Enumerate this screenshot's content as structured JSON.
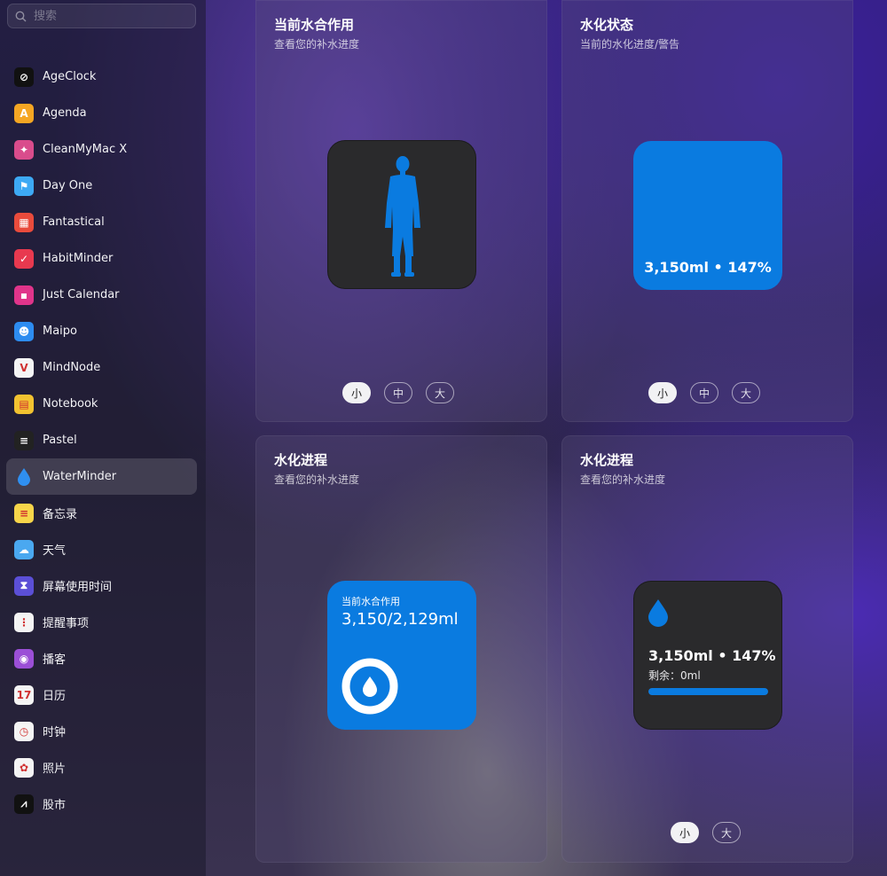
{
  "search": {
    "placeholder": "搜索"
  },
  "sidebar": {
    "items": [
      {
        "label": "AgeClock",
        "icon": "ageclock-icon",
        "color": "#111111",
        "glyph": "⊘"
      },
      {
        "label": "Agenda",
        "icon": "agenda-icon",
        "color": "#f5a623",
        "glyph": "A"
      },
      {
        "label": "CleanMyMac X",
        "icon": "cleanmymac-icon",
        "color": "#d94c8c",
        "glyph": "✦"
      },
      {
        "label": "Day One",
        "icon": "dayone-icon",
        "color": "#3da9f4",
        "glyph": "⚑"
      },
      {
        "label": "Fantastical",
        "icon": "fantastical-icon",
        "color": "#e94b3c",
        "glyph": "▦"
      },
      {
        "label": "HabitMinder",
        "icon": "habitminder-icon",
        "color": "#e8394f",
        "glyph": "✓"
      },
      {
        "label": "Just Calendar",
        "icon": "justcalendar-icon",
        "color": "#e0348a",
        "glyph": "▪"
      },
      {
        "label": "Maipo",
        "icon": "maipo-icon",
        "color": "#2d8cf0",
        "glyph": "☻"
      },
      {
        "label": "MindNode",
        "icon": "mindnode-icon",
        "color": "#f4f4f4",
        "glyph": "V"
      },
      {
        "label": "Notebook",
        "icon": "notebook-icon",
        "color": "#f2c230",
        "glyph": "▤"
      },
      {
        "label": "Pastel",
        "icon": "pastel-icon",
        "color": "#222222",
        "glyph": "≡"
      },
      {
        "label": "WaterMinder",
        "icon": "water-drop-icon",
        "color": "#2a2a3a",
        "glyph": "💧",
        "active": true
      },
      {
        "label": "备忘录",
        "icon": "notes-icon",
        "color": "#f7d54a",
        "glyph": "≡"
      },
      {
        "label": "天气",
        "icon": "weather-icon",
        "color": "#4aa8f0",
        "glyph": "☁"
      },
      {
        "label": "屏幕使用时间",
        "icon": "screen-time-icon",
        "color": "#5b4fd6",
        "glyph": "⧗"
      },
      {
        "label": "提醒事项",
        "icon": "reminders-icon",
        "color": "#f4f4f4",
        "glyph": "⋮"
      },
      {
        "label": "播客",
        "icon": "podcasts-icon",
        "color": "#9b4fd6",
        "glyph": "◉"
      },
      {
        "label": "日历",
        "icon": "calendar-icon",
        "color": "#f4f4f4",
        "glyph": "17"
      },
      {
        "label": "时钟",
        "icon": "clock-icon",
        "color": "#f4f4f4",
        "glyph": "◷"
      },
      {
        "label": "照片",
        "icon": "photos-icon",
        "color": "#f4f4f4",
        "glyph": "✿"
      },
      {
        "label": "股市",
        "icon": "stocks-icon",
        "color": "#111111",
        "glyph": "⩘"
      }
    ]
  },
  "cards": {
    "c1": {
      "title": "当前水合作用",
      "subtitle": "查看您的补水进度",
      "sizes": [
        "小",
        "中",
        "大"
      ],
      "selected": 0
    },
    "c2": {
      "title": "水化状态",
      "subtitle": "当前的水化进度/警告",
      "sizes": [
        "小",
        "中",
        "大"
      ],
      "selected": 0,
      "status_text": "3,150ml • 147%"
    },
    "c3": {
      "title": "水化进程",
      "subtitle": "查看您的补水进度",
      "widget_title": "当前水合作用",
      "widget_value": "3,150/2,129ml"
    },
    "c4": {
      "title": "水化进程",
      "subtitle": "查看您的补水进度",
      "sizes": [
        "小",
        "大"
      ],
      "selected": 0,
      "value": "3,150ml • 147%",
      "remaining": "剩余：0ml",
      "progress": 1.0
    }
  },
  "colors": {
    "accent": "#0a7be0",
    "dark_widget": "#2a2a2c"
  }
}
